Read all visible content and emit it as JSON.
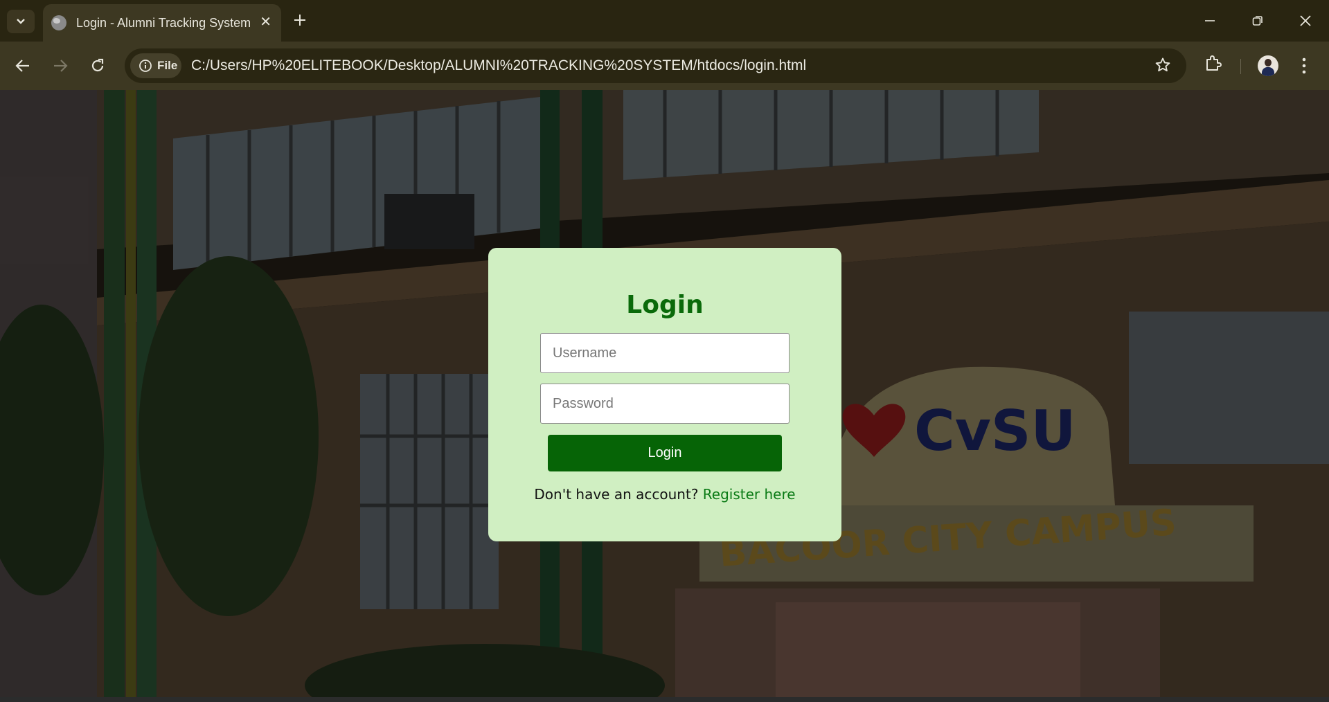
{
  "browser": {
    "tab_title": "Login - Alumni Tracking System",
    "site_chip_label": "File",
    "url": "C:/Users/HP%20ELITEBOOK/Desktop/ALUMNI%20TRACKING%20SYSTEM/htdocs/login.html",
    "icons": [
      "tab-search-icon",
      "globe-icon",
      "close-icon",
      "plus-icon",
      "minimize-icon",
      "restore-icon",
      "window-close-icon",
      "back-arrow-icon",
      "forward-arrow-icon",
      "reload-icon",
      "info-icon",
      "star-icon",
      "extensions-icon",
      "profile-avatar",
      "kebab-menu-icon"
    ]
  },
  "background": {
    "sign_text": "CvSU",
    "sign_subtext": "BACOOR CITY CAMPUS"
  },
  "login": {
    "title": "Login",
    "username_placeholder": "Username",
    "password_placeholder": "Password",
    "button_label": "Login",
    "register_prompt": "Don't have an account?",
    "register_link": "Register here"
  },
  "colors": {
    "card_bg": "#d0efc2",
    "title": "#0a6a0a",
    "button": "#066406",
    "link": "#0b7b16"
  }
}
